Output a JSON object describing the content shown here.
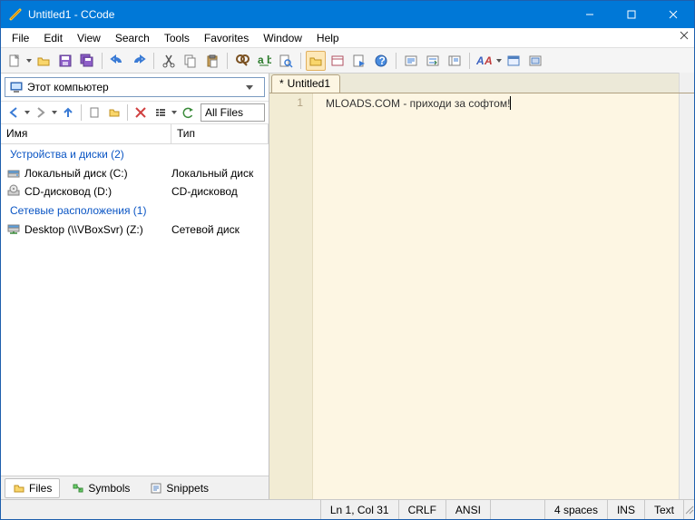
{
  "window": {
    "title": "Untitled1 - CCode"
  },
  "menu": {
    "items": [
      "File",
      "Edit",
      "View",
      "Search",
      "Tools",
      "Favorites",
      "Window",
      "Help"
    ]
  },
  "sidebar": {
    "combo": "Этот компьютер",
    "filter": "All Files",
    "headers": {
      "name": "Имя",
      "type": "Тип"
    },
    "group1": {
      "label": "Устройства и диски (2)"
    },
    "rows1": [
      {
        "name": "Локальный диск (C:)",
        "type": "Локальный диск"
      },
      {
        "name": "CD-дисковод (D:)",
        "type": "CD-дисковод"
      }
    ],
    "group2": {
      "label": "Сетевые расположения (1)"
    },
    "rows2": [
      {
        "name": "Desktop (\\\\VBoxSvr) (Z:)",
        "type": "Сетевой диск"
      }
    ],
    "tabs": {
      "files": "Files",
      "symbols": "Symbols",
      "snippets": "Snippets"
    }
  },
  "editor": {
    "tab": {
      "modified": "*",
      "name": "Untitled1"
    },
    "line_no": "1",
    "content": "MLOADS.COM - приходи за софтом!"
  },
  "status": {
    "pos": "Ln 1, Col 31",
    "eol": "CRLF",
    "enc": "ANSI",
    "indent": "4 spaces",
    "ins": "INS",
    "lang": "Text"
  }
}
